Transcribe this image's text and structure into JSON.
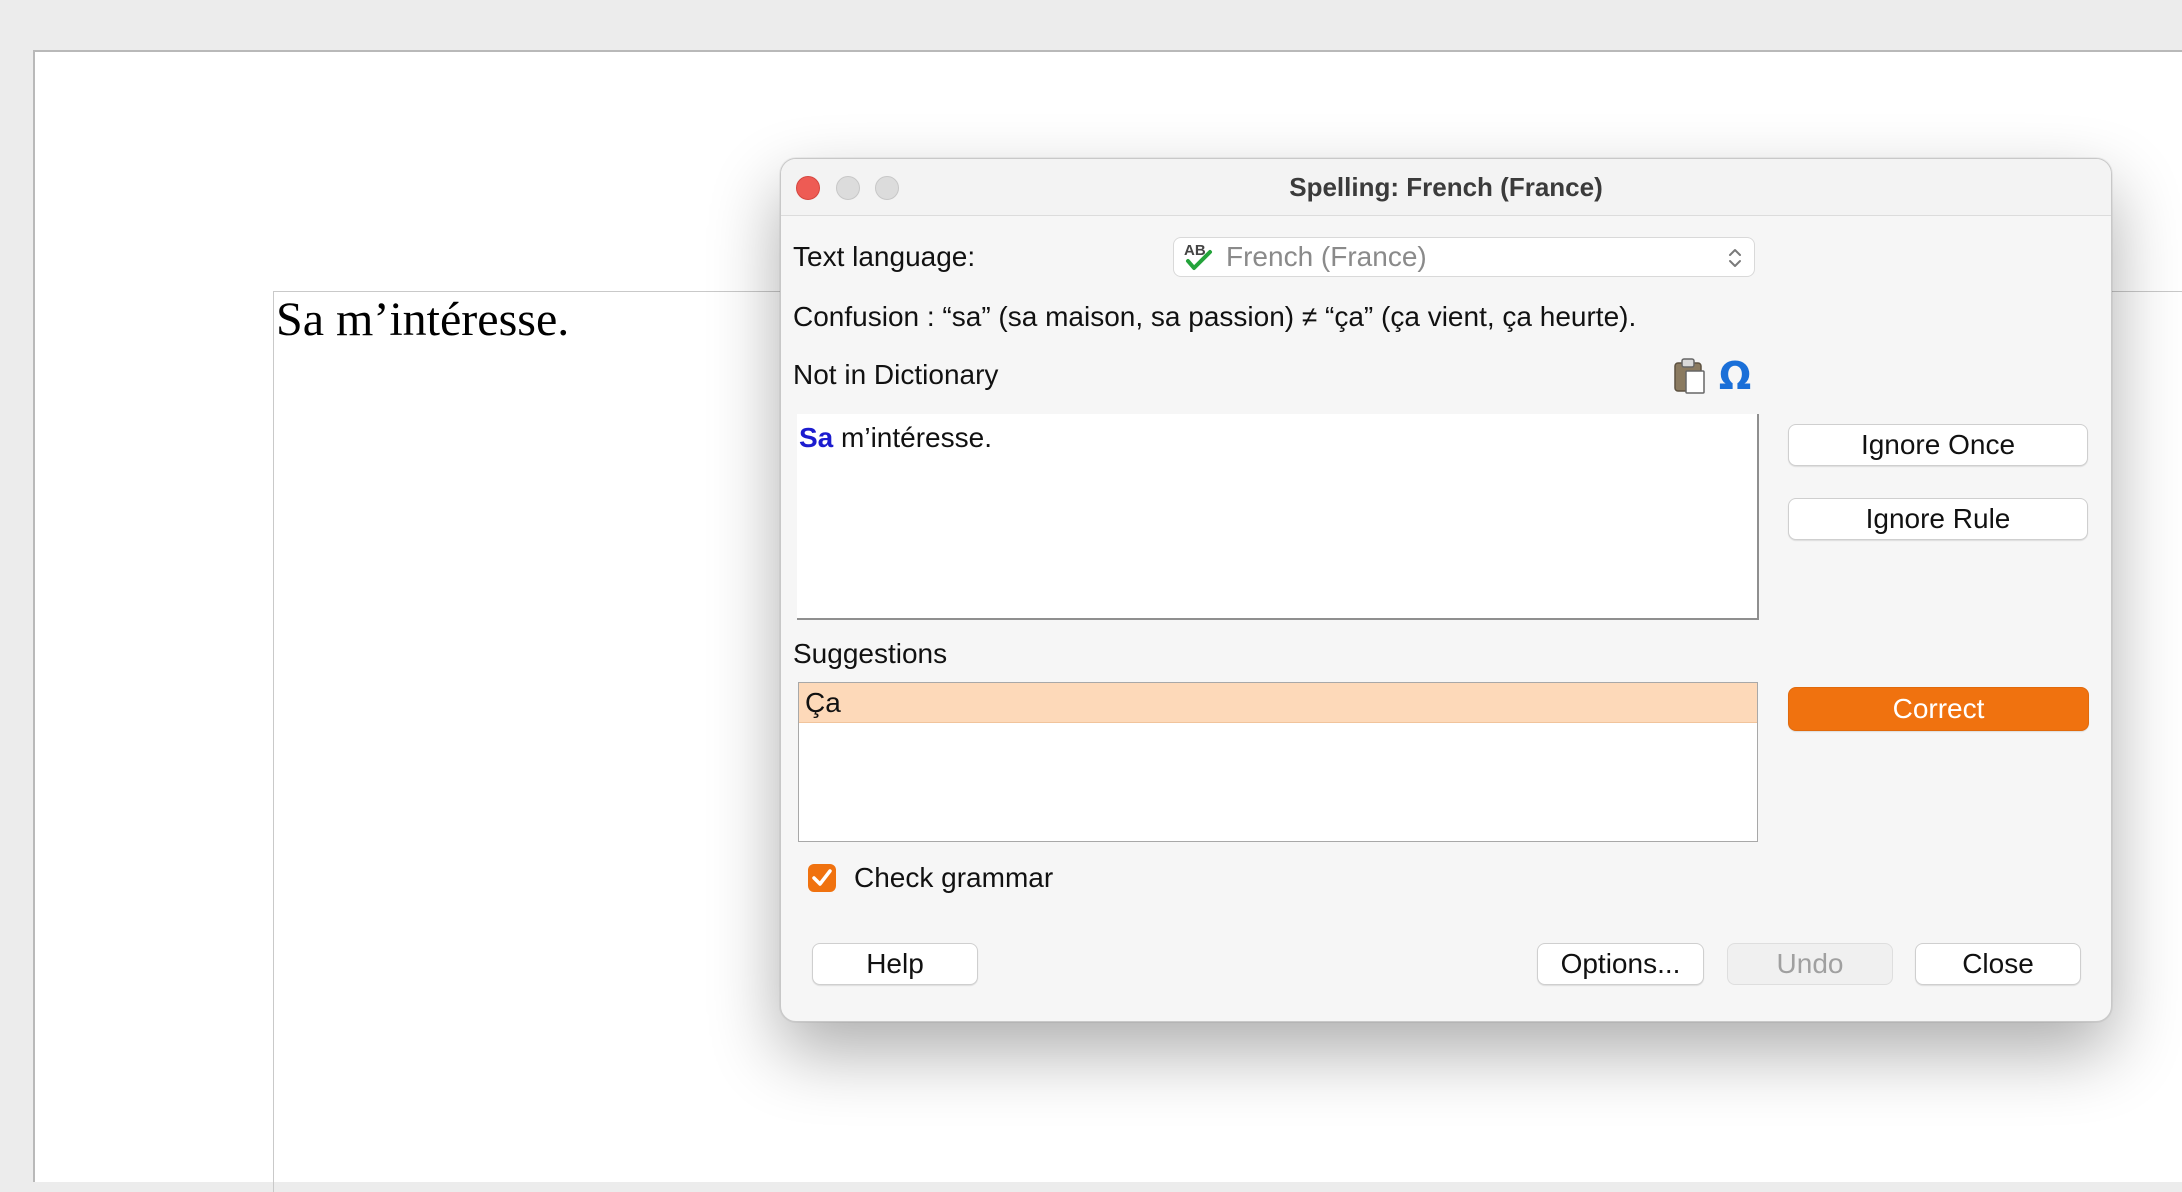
{
  "document": {
    "text": "Sa m’intéresse."
  },
  "dialog": {
    "title": "Spelling: French (France)",
    "text_language_label": "Text language:",
    "language": {
      "selected": "French (France)",
      "icon": "spellcheck-ab-icon"
    },
    "rule_message": "Confusion : “sa” (sa maison, sa passion) ≠ “ça” (ça vient, ça heurte).",
    "not_in_dictionary_label": "Not in Dictionary",
    "toolbar_icons": [
      "paste-icon",
      "special-character-omega-icon"
    ],
    "sentence": {
      "error_word": "Sa",
      "rest": " m’intéresse."
    },
    "suggestions_label": "Suggestions",
    "suggestions": [
      "Ça"
    ],
    "check_grammar": {
      "label": "Check grammar",
      "checked": true
    },
    "buttons": {
      "ignore_once": "Ignore Once",
      "ignore_rule": "Ignore Rule",
      "correct": "Correct",
      "help": "Help",
      "options": "Options...",
      "undo": "Undo",
      "close": "Close"
    }
  },
  "colors": {
    "accent": "#f0720f",
    "suggestion_highlight": "#fdd9b9",
    "error_word": "#1c1ccf",
    "close_light": "#ee5b54"
  }
}
